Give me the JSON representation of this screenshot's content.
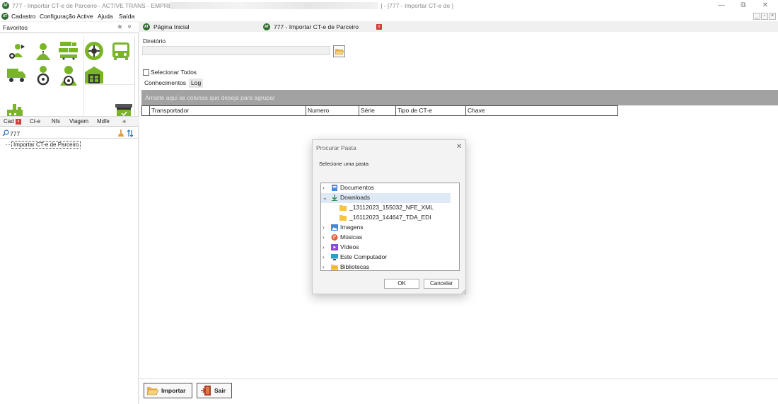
{
  "window": {
    "title_left": "777 - Importar CT-e de Parceiro - ACTIVE TRANS - EMPRESA",
    "title_right": "] - [777 - Importar CT-e de ]",
    "logo_text": "AT",
    "minimize": "—",
    "restore": "⧉",
    "close": "✕"
  },
  "menu": {
    "items": [
      "Cadastro",
      "Configuração Active",
      "Ajuda",
      "Saída"
    ],
    "mdi_minimize": "_",
    "mdi_restore": "▫",
    "mdi_close": "×"
  },
  "left_panel": {
    "favorites_label": "Favoritos",
    "star": "★",
    "pin": "ᵠ",
    "icons": [
      "add-user-icon",
      "person-icon",
      "trucks-fleet-icon",
      "tire-icon",
      "bus-icon",
      "delivery-truck-icon",
      "driver-icon",
      "driver-wheel-icon",
      "warehouse-icon",
      "factory-icon",
      "trash-can-icon"
    ],
    "tabs": [
      "Cad",
      "Ct-e",
      "Nfs",
      "Viagem",
      "Mdfe"
    ],
    "tabs_arrow": "◄",
    "close_x": "x",
    "search_value": "777",
    "tree_item": "Importar CT-e de Parceiro"
  },
  "doc_tabs": {
    "home": "Página Inicial",
    "active": "777 - Importar CT-e de Parceiro",
    "close_x": "x"
  },
  "main": {
    "directory_label": "Diretório",
    "directory_value": "",
    "select_all": "Selecionar Todos",
    "tabs": [
      "Conhecimentos",
      "Log"
    ],
    "group_hint": "Arraste aqui as colunas que deseja para agrupar",
    "columns": [
      "Transportador",
      "Numero",
      "Série",
      "Tipo de CT-e",
      "Chave"
    ]
  },
  "buttons": {
    "import": "Importar",
    "exit": "Sair"
  },
  "dialog": {
    "title": "Procurar Pasta",
    "close": "✕",
    "prompt": "Selecione uma pasta",
    "tree": [
      {
        "label": "Documentos",
        "icon": "documents-icon",
        "chevron": "›"
      },
      {
        "label": "Downloads",
        "icon": "downloads-icon",
        "chevron": "⌄"
      },
      {
        "label": "_13112023_155032_NFE_XML",
        "icon": "folder-icon",
        "chevron": ""
      },
      {
        "label": "_16112023_144647_TDA_EDI",
        "icon": "folder-icon",
        "chevron": ""
      },
      {
        "label": "Imagens",
        "icon": "pictures-icon",
        "chevron": "›"
      },
      {
        "label": "Músicas",
        "icon": "music-icon",
        "chevron": "›"
      },
      {
        "label": "Vídeos",
        "icon": "videos-icon",
        "chevron": "›"
      },
      {
        "label": "Este Computador",
        "icon": "computer-icon",
        "chevron": "›"
      },
      {
        "label": "Bibliotecas",
        "icon": "libraries-icon",
        "chevron": "›"
      }
    ],
    "ok": "OK",
    "cancel": "Cancelar"
  },
  "colors": {
    "brand_green": "#7ab527",
    "logo_dark": "#2f6b2f",
    "group_bar": "#a2a2a2",
    "close_red": "#d23c3c",
    "selected_row": "#dfe9f5"
  }
}
